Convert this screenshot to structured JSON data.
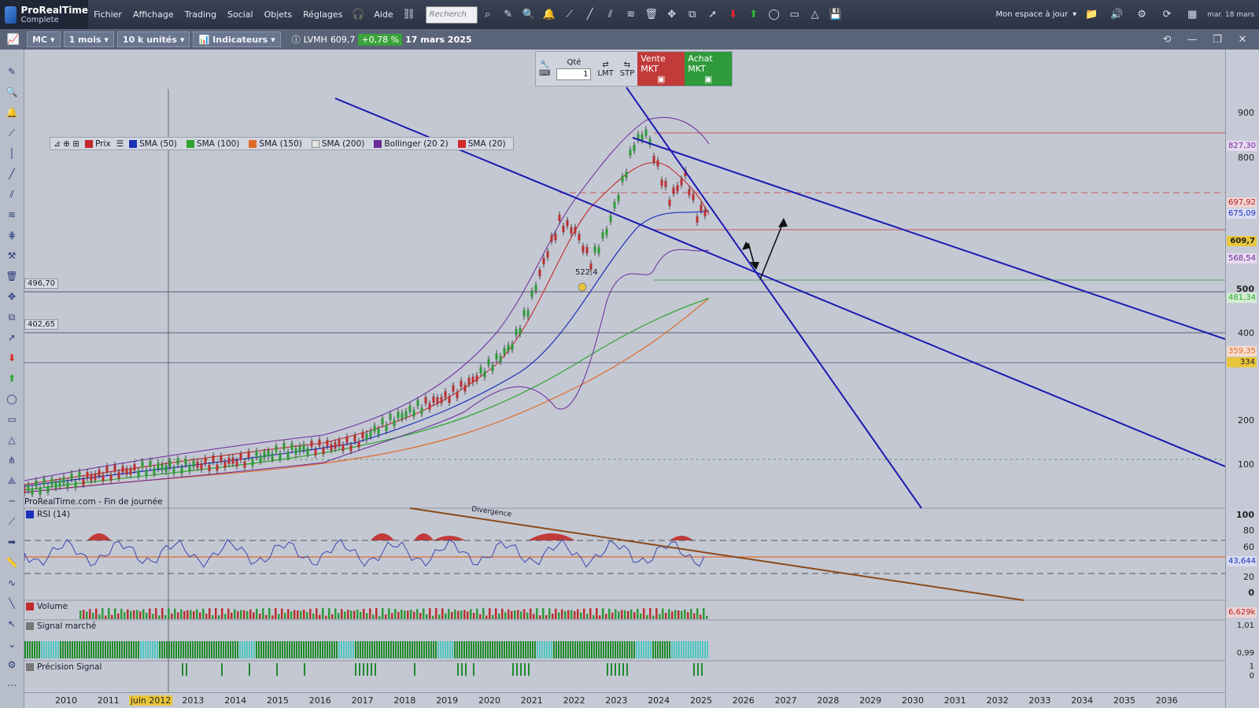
{
  "app": {
    "name": "ProRealTime",
    "edition": "Complete",
    "clock": "mar. 18 mars"
  },
  "menu": [
    "Fichier",
    "Affichage",
    "Trading",
    "Social",
    "Objets",
    "Réglages",
    "Aide"
  ],
  "search": {
    "placeholder": "Recherch"
  },
  "workspace": {
    "label": "Mon espace à jour"
  },
  "toolbar": {
    "ticker": "MC",
    "period": "1 mois",
    "units": "10 k unités",
    "indicators": "Indicateurs"
  },
  "quote": {
    "name": "LVMH",
    "price": "609,7",
    "change": "+0,78 %",
    "date": "17 mars 2025"
  },
  "order": {
    "qty_label": "Qté",
    "qty_value": "1",
    "lmt": "LMT",
    "stp": "STP",
    "sell": "Vente MKT",
    "buy": "Achat MKT"
  },
  "legend": [
    {
      "label": "Prix",
      "color": "#c22b2b"
    },
    {
      "label": "SMA (50)",
      "color": "#1a2fb8"
    },
    {
      "label": "SMA (100)",
      "color": "#2ea52e"
    },
    {
      "label": "SMA (150)",
      "color": "#e06a2a"
    },
    {
      "label": "SMA (200)",
      "color": "#d8d8d8"
    },
    {
      "label": "Bollinger (20 2)",
      "color": "#6a2c9a"
    },
    {
      "label": "SMA (20)",
      "color": "#d22a2a"
    }
  ],
  "price_axis": [
    "900",
    "800",
    "500",
    "400",
    "200",
    "100"
  ],
  "price_tags": [
    {
      "text": "827,30",
      "bg": "#e7d9ef",
      "fg": "#6a2c9a"
    },
    {
      "text": "697,92",
      "bg": "#f0d3d3",
      "fg": "#b22222"
    },
    {
      "text": "675,09",
      "bg": "#d9dcf2",
      "fg": "#1a2fb8"
    },
    {
      "text": "609,7",
      "bg": "#e8c53a",
      "fg": "#222"
    },
    {
      "text": "568,54",
      "bg": "#e7d9ef",
      "fg": "#6a2c9a"
    },
    {
      "text": "481,34",
      "bg": "#d2edd2",
      "fg": "#2ea52e"
    },
    {
      "text": "359,35",
      "bg": "#f6dccb",
      "fg": "#e06a2a"
    },
    {
      "text": "334",
      "bg": "#e8c53a",
      "fg": "#222"
    }
  ],
  "hlines": {
    "a": "496,70",
    "b": "402,65"
  },
  "annotations": {
    "low": "522,4",
    "divergence": "Divergence"
  },
  "footer_source": "ProRealTime.com - Fin de journée",
  "rsi": {
    "label": "RSI (14)",
    "axis": [
      "100",
      "80",
      "60",
      "20",
      "0"
    ],
    "value": "43,644"
  },
  "volume": {
    "label": "Volume",
    "value": "6,629k"
  },
  "signal": {
    "label": "Signal marché",
    "axis": [
      "1,01",
      "0,99"
    ]
  },
  "precision": {
    "label": "Précision Signal",
    "axis": [
      "1",
      "0"
    ]
  },
  "xaxis": [
    "2010",
    "2011",
    "2012",
    "2013",
    "2014",
    "2015",
    "2016",
    "2017",
    "2018",
    "2019",
    "2020",
    "2021",
    "2022",
    "2023",
    "2024",
    "2025",
    "2026",
    "2027",
    "2028",
    "2029",
    "2030",
    "2031",
    "2032",
    "2033",
    "2034",
    "2035",
    "2036"
  ],
  "cursor_date": "juin 2012"
}
